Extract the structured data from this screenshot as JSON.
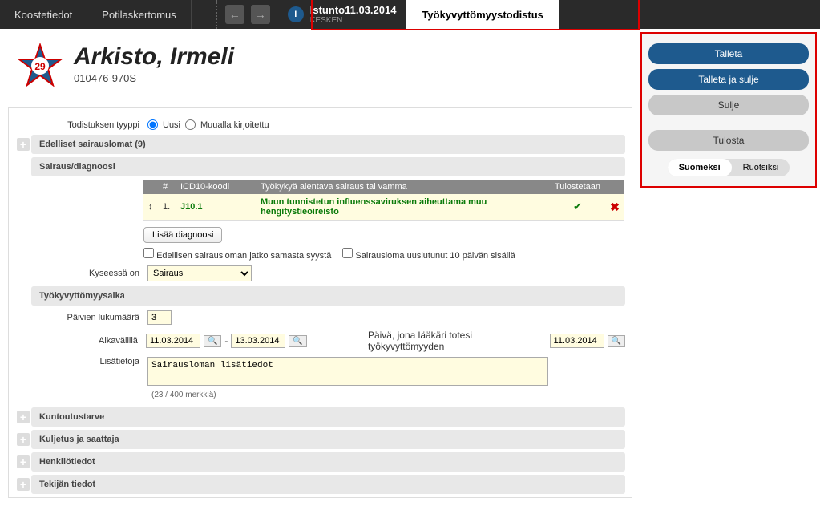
{
  "topbar": {
    "tab1": "Koostetiedot",
    "tab2": "Potilaskertomus",
    "session_label": "Istunto11.03.2014",
    "session_status": "KESKEN",
    "session_letter": "I",
    "active_tab": "Työkyvyttömyystodistus"
  },
  "patient": {
    "name": "Arkisto, Irmeli",
    "id": "010476-970S",
    "badge_num": "29"
  },
  "right": {
    "save": "Talleta",
    "save_close": "Talleta ja sulje",
    "close": "Sulje",
    "print": "Tulosta",
    "lang_fi": "Suomeksi",
    "lang_sv": "Ruotsiksi"
  },
  "form": {
    "type_label": "Todistuksen tyyppi",
    "type_new": "Uusi",
    "type_elsewhere": "Muualla kirjoitettu",
    "prev_sickleave": "Edelliset sairauslomat (9)",
    "diagnosis_header": "Sairaus/diagnoosi",
    "table": {
      "col_num": "#",
      "col_icd": "ICD10-koodi",
      "col_desc": "Työkykyä alentava sairaus tai vamma",
      "col_print": "Tulostetaan",
      "row1_num": "1.",
      "row1_icd": "J10.1",
      "row1_desc": "Muun tunnistetun influenssaviruksen aiheuttama muu hengitystieoireisto"
    },
    "add_diag": "Lisää diagnoosi",
    "chk_continuation": "Edellisen sairausloman jatko samasta syystä",
    "chk_renewed": "Sairausloma uusiutunut 10 päivän sisällä",
    "case_label": "Kyseessä on",
    "case_value": "Sairaus",
    "period_header": "Työkyvyttömyysaika",
    "days_label": "Päivien lukumäärä",
    "days_value": "3",
    "range_label": "Aikavälillä",
    "date_from": "11.03.2014",
    "date_to": "13.03.2014",
    "doctor_date_label": "Päivä, jona lääkäri totesi työkyvyttömyyden",
    "doctor_date": "11.03.2014",
    "extra_label": "Lisätietoja",
    "extra_value": "Sairausloman lisätiedot",
    "char_count": "(23 / 400 merkkiä)",
    "rehab_header": "Kuntoutustarve",
    "transport_header": "Kuljetus ja saattaja",
    "personal_header": "Henkilötiedot",
    "author_header": "Tekijän tiedot"
  }
}
